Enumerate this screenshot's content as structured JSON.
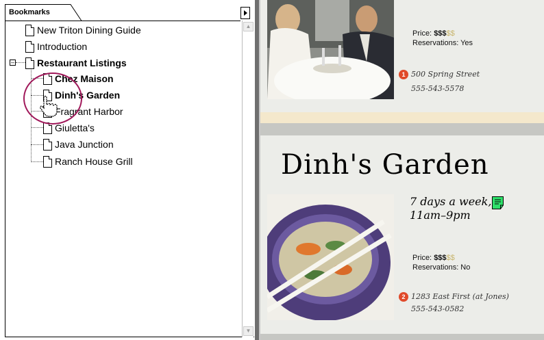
{
  "bookmarks": {
    "tab_label": "Bookmarks",
    "items": [
      {
        "label": "New Triton Dining Guide",
        "bold": false
      },
      {
        "label": "Introduction",
        "bold": false
      },
      {
        "label": "Restaurant Listings",
        "bold": true,
        "expanded": true
      },
      {
        "label": "Chez Maison",
        "bold": true
      },
      {
        "label": "Dinh's Garden",
        "bold": true
      },
      {
        "label": "Fragrant Harbor",
        "bold": false
      },
      {
        "label": "Giuletta's",
        "bold": false
      },
      {
        "label": "Java Junction",
        "bold": false
      },
      {
        "label": "Ranch House Grill",
        "bold": false
      }
    ]
  },
  "listing1": {
    "price_label": "Price: ",
    "price_on": "$$$",
    "price_off": "$$",
    "reservations": "Reservations: Yes",
    "pin": "1",
    "address": "500 Spring Street",
    "phone": "555-543-5578"
  },
  "listing2": {
    "title": "Dinh's Garden",
    "hours_line1": "7 days a week,",
    "hours_line2": "11am–9pm",
    "price_label": "Price: ",
    "price_on": "$$$",
    "price_off": "$$",
    "reservations": "Reservations: No",
    "pin": "2",
    "address": "1283 East First (at Jones)",
    "phone": "555-543-0582"
  },
  "colors": {
    "accent_circle": "#a0185a",
    "pin": "#e04a2a",
    "note": "#2ee06a"
  }
}
